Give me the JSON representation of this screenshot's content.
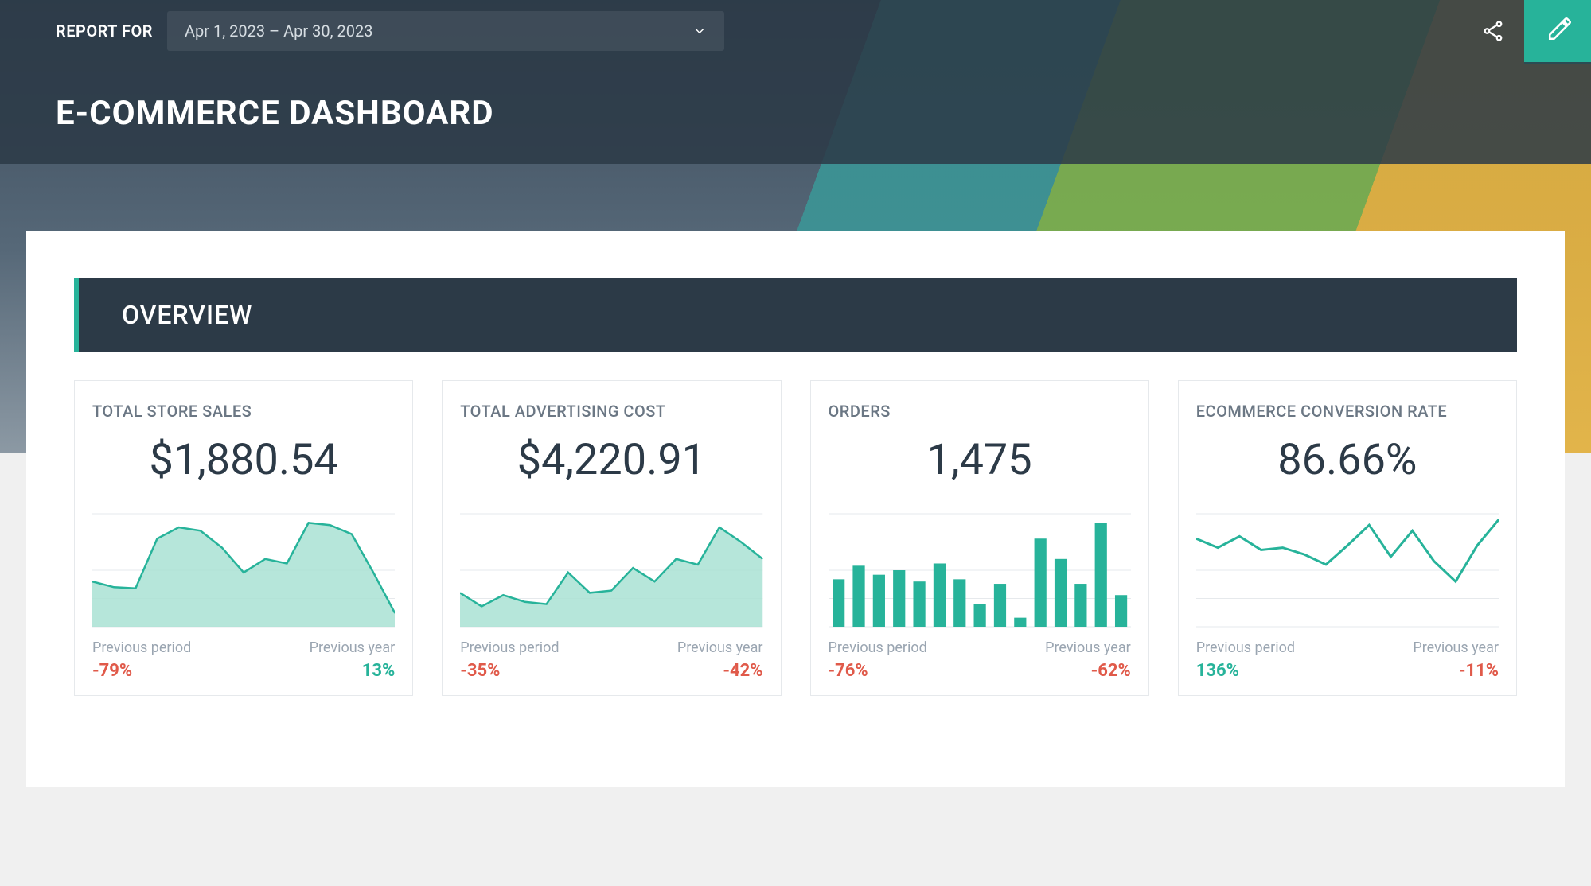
{
  "topbar": {
    "report_for_label": "REPORT FOR",
    "date_range": "Apr 1, 2023 – Apr 30, 2023"
  },
  "title": "E-COMMERCE DASHBOARD",
  "section": {
    "overview_label": "OVERVIEW"
  },
  "kpis": [
    {
      "id": "total_store_sales",
      "title": "TOTAL STORE SALES",
      "value": "$1,880.54",
      "prev_period_label": "Previous period",
      "prev_period_value": "-79%",
      "prev_period_sign": "neg",
      "prev_year_label": "Previous year",
      "prev_year_value": "13%",
      "prev_year_sign": "pos",
      "chart_type": "area"
    },
    {
      "id": "total_advertising_cost",
      "title": "TOTAL ADVERTISING COST",
      "value": "$4,220.91",
      "prev_period_label": "Previous period",
      "prev_period_value": "-35%",
      "prev_period_sign": "neg",
      "prev_year_label": "Previous year",
      "prev_year_value": "-42%",
      "prev_year_sign": "neg",
      "chart_type": "area"
    },
    {
      "id": "orders",
      "title": "ORDERS",
      "value": "1,475",
      "prev_period_label": "Previous period",
      "prev_period_value": "-76%",
      "prev_period_sign": "neg",
      "prev_year_label": "Previous year",
      "prev_year_value": "-62%",
      "prev_year_sign": "neg",
      "chart_type": "bar"
    },
    {
      "id": "ecommerce_conversion_rate",
      "title": "ECOMMERCE CONVERSION RATE",
      "value": "86.66%",
      "prev_period_label": "Previous period",
      "prev_period_value": "136%",
      "prev_period_sign": "pos",
      "prev_year_label": "Previous year",
      "prev_year_value": "-11%",
      "prev_year_sign": "neg",
      "chart_type": "line"
    }
  ],
  "chart_data": [
    {
      "type": "area",
      "title": "TOTAL STORE SALES sparkline",
      "x": [
        1,
        2,
        3,
        4,
        5,
        6,
        7,
        8,
        9,
        10,
        11,
        12,
        13,
        14,
        15
      ],
      "values": [
        40,
        35,
        34,
        78,
        88,
        85,
        70,
        48,
        60,
        56,
        92,
        90,
        82,
        48,
        12
      ],
      "ylim": [
        0,
        100
      ]
    },
    {
      "type": "area",
      "title": "TOTAL ADVERTISING COST sparkline",
      "x": [
        1,
        2,
        3,
        4,
        5,
        6,
        7,
        8,
        9,
        10,
        11,
        12,
        13,
        14,
        15
      ],
      "values": [
        30,
        18,
        28,
        22,
        20,
        48,
        30,
        32,
        52,
        40,
        60,
        55,
        88,
        75,
        60
      ],
      "ylim": [
        0,
        100
      ]
    },
    {
      "type": "bar",
      "title": "ORDERS sparkline",
      "categories": [
        1,
        2,
        3,
        4,
        5,
        6,
        7,
        8,
        9,
        10,
        11,
        12,
        13,
        14,
        15
      ],
      "values": [
        42,
        54,
        46,
        50,
        40,
        56,
        42,
        20,
        38,
        8,
        78,
        60,
        38,
        92,
        28
      ],
      "ylim": [
        0,
        100
      ]
    },
    {
      "type": "line",
      "title": "ECOMMERCE CONVERSION RATE sparkline",
      "x": [
        1,
        2,
        3,
        4,
        5,
        6,
        7,
        8,
        9,
        10,
        11,
        12,
        13,
        14,
        15
      ],
      "values": [
        78,
        70,
        80,
        68,
        70,
        64,
        55,
        72,
        90,
        62,
        85,
        58,
        40,
        72,
        95
      ],
      "ylim": [
        0,
        100
      ]
    }
  ]
}
